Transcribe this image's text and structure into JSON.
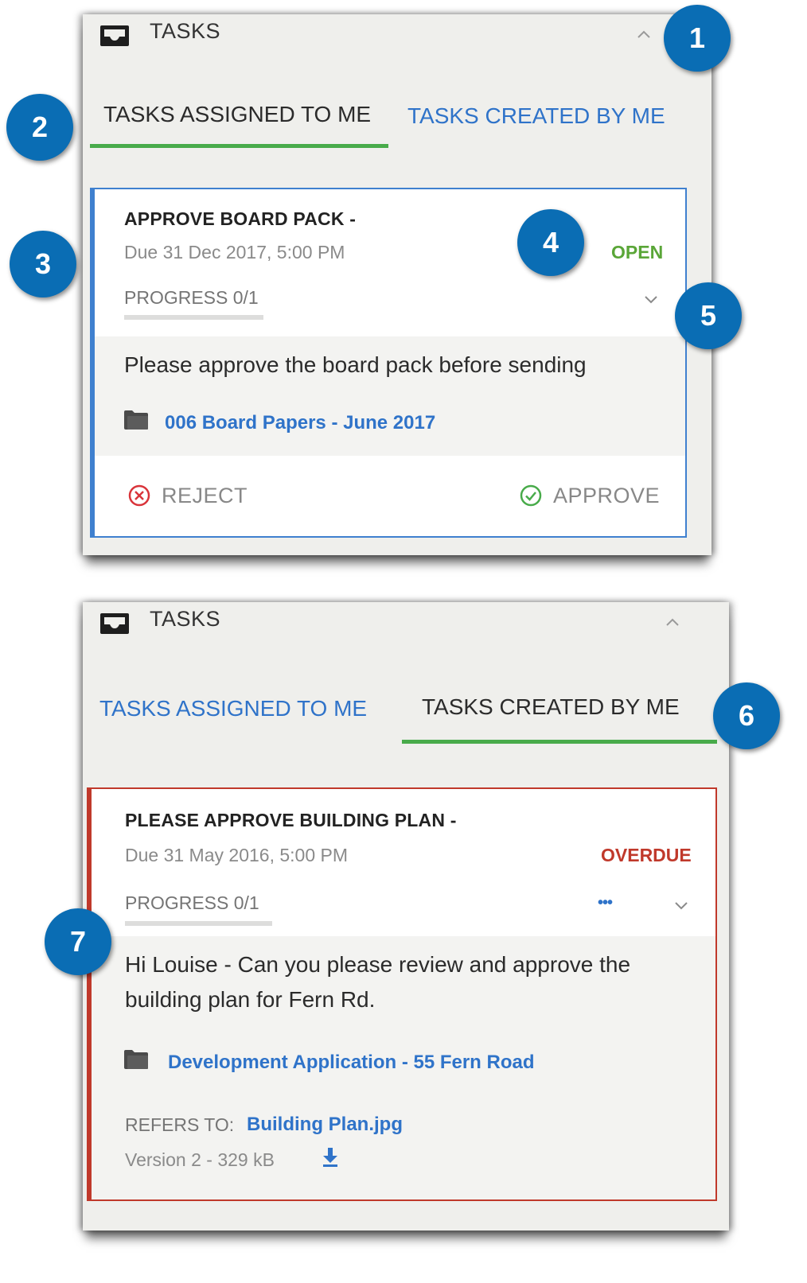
{
  "colors": {
    "accent_blue": "#2f73c9",
    "active_underline": "#48ab4a",
    "open_status": "#5aa638",
    "overdue_status": "#c0392b",
    "badge": "#0a6db4",
    "card1_border": "#3f80cf",
    "card2_border": "#c0392b"
  },
  "panel1": {
    "header": {
      "title": "TASKS",
      "tray_icon": "tray-icon",
      "caret_icon": "chevron-up-icon"
    },
    "tabs": {
      "assigned": "TASKS ASSIGNED TO ME",
      "created": "TASKS CREATED BY ME",
      "active": "assigned"
    },
    "card": {
      "title": "APPROVE BOARD PACK -",
      "due": "Due 31 Dec 2017, 5:00 PM",
      "status": "OPEN",
      "progress_label": "PROGRESS 0/1",
      "progress_fraction": 0,
      "description": "Please approve the board pack before sending",
      "folder_link": "006 Board Papers - June 2017",
      "reject_label": "REJECT",
      "approve_label": "APPROVE"
    }
  },
  "panel2": {
    "header": {
      "title": "TASKS",
      "tray_icon": "tray-icon",
      "caret_icon": "chevron-up-icon"
    },
    "tabs": {
      "assigned": "TASKS ASSIGNED TO ME",
      "created": "TASKS CREATED BY ME",
      "active": "created"
    },
    "card": {
      "title": "PLEASE APPROVE BUILDING PLAN -",
      "due": "Due 31 May 2016, 5:00 PM",
      "status": "OVERDUE",
      "progress_label": "PROGRESS 0/1",
      "progress_fraction": 0,
      "more_label": "•••",
      "description": "Hi Louise - Can you please review and approve the building plan for Fern Rd.",
      "folder_link": "Development Application - 55 Fern Road",
      "refers_label": "REFERS TO:",
      "refers_file": "Building Plan.jpg",
      "version_info": "Version 2 - 329 kB"
    }
  },
  "badges": [
    "1",
    "2",
    "3",
    "4",
    "5",
    "6",
    "7"
  ]
}
